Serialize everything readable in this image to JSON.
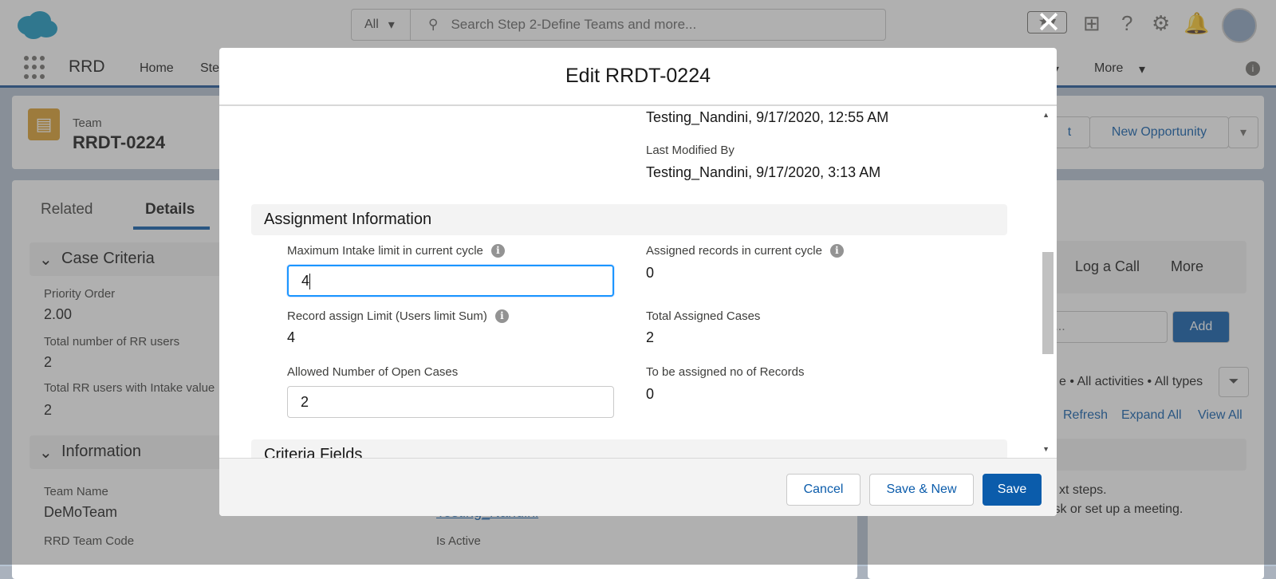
{
  "header": {
    "search_scope": "All",
    "search_placeholder": "Search Step 2-Define Teams and more..."
  },
  "nav": {
    "app_name": "RRD",
    "items": [
      {
        "label": "Home"
      },
      {
        "label": "Ste"
      },
      {
        "label": "More"
      }
    ]
  },
  "record": {
    "object_label": "Team",
    "name": "RRDT-0224",
    "buttons": [
      "t",
      "New Opportunity"
    ]
  },
  "tabs": [
    {
      "label": "Related"
    },
    {
      "label": "Details"
    }
  ],
  "background_detail": {
    "case_criteria_title": "Case Criteria",
    "priority_order_label": "Priority Order",
    "priority_order_value": "2.00",
    "total_rr_users_label": "Total number of RR users",
    "total_rr_users_value": "2",
    "total_rr_intake_label": "Total RR users with Intake value",
    "total_rr_intake_value": "2",
    "information_title": "Information",
    "team_name_label": "Team Name",
    "team_name_value": "DeMoTeam",
    "owner_value": "Testing_Nandini",
    "team_code_label": "RRD Team Code",
    "is_active_label": "Is Active"
  },
  "activity": {
    "tabs": [
      "Log a Call",
      "More"
    ],
    "input_placeholder": "nt...",
    "add_label": "Add",
    "filter_text": "e • All activities • All types",
    "links": [
      "Refresh",
      "Expand All",
      "View All"
    ],
    "empty_line1": "xt steps.",
    "empty_line2": "To get things moving, add a task or set up a meeting."
  },
  "modal": {
    "close_label": "✕",
    "title": "Edit RRDT-0224",
    "created_by_value": "Testing_Nandini, 9/17/2020, 12:55 AM",
    "last_modified_label": "Last Modified By",
    "last_modified_value": "Testing_Nandini, 9/17/2020, 3:13 AM",
    "assignment_section": "Assignment Information",
    "max_intake_label": "Maximum Intake limit in current cycle",
    "max_intake_value": "4",
    "assigned_records_label": "Assigned records in current cycle",
    "assigned_records_value": "0",
    "record_assign_limit_label": "Record assign Limit (Users limit Sum)",
    "record_assign_limit_value": "4",
    "total_assigned_label": "Total Assigned Cases",
    "total_assigned_value": "2",
    "allowed_open_label": "Allowed Number of Open Cases",
    "allowed_open_value": "2",
    "to_be_assigned_label": "To be assigned no of Records",
    "to_be_assigned_value": "0",
    "criteria_section": "Criteria Fields",
    "cancel_label": "Cancel",
    "save_new_label": "Save & New",
    "save_label": "Save"
  },
  "icons": {
    "info": "i"
  }
}
